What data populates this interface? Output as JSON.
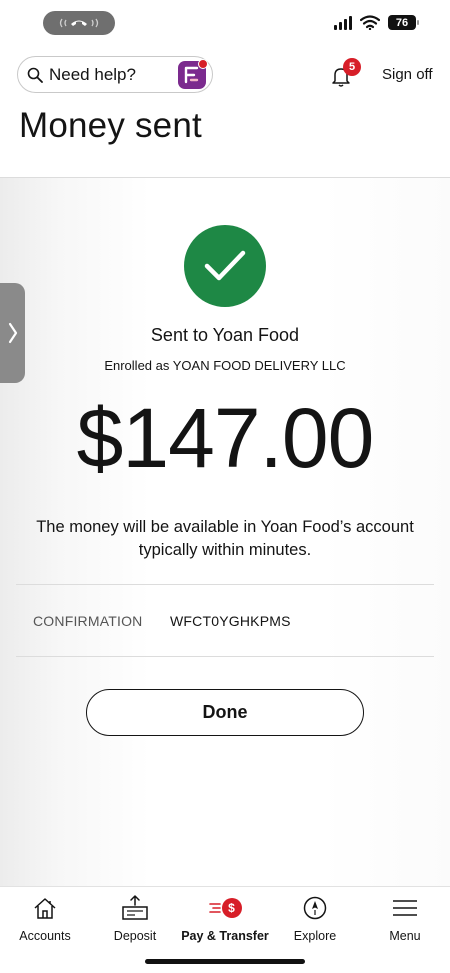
{
  "status_bar": {
    "battery": "76"
  },
  "header": {
    "search_label": "Need help?",
    "notification_count": "5",
    "sign_off": "Sign off"
  },
  "page_title": "Money sent",
  "confirmation_screen": {
    "recipient": "Sent to Yoan Food",
    "enrolled": "Enrolled as YOAN FOOD DELIVERY LLC",
    "amount": "$147.00",
    "availability_note": "The money will be available in Yoan Food’s account typically within minutes.",
    "confirmation_label": "CONFIRMATION",
    "confirmation_number": "WFCT0YGHKPMS",
    "done_label": "Done"
  },
  "bottom_nav": {
    "items": [
      {
        "label": "Accounts",
        "icon": "home-icon"
      },
      {
        "label": "Deposit",
        "icon": "deposit-icon"
      },
      {
        "label": "Pay & Transfer",
        "icon": "pay-transfer-icon",
        "badge": "$",
        "active": true
      },
      {
        "label": "Explore",
        "icon": "compass-icon"
      },
      {
        "label": "Menu",
        "icon": "hamburger-menu-icon"
      }
    ]
  },
  "colors": {
    "success_green": "#1e8845",
    "brand_red": "#d71e28",
    "fargo_purple": "#7b2a8e"
  }
}
